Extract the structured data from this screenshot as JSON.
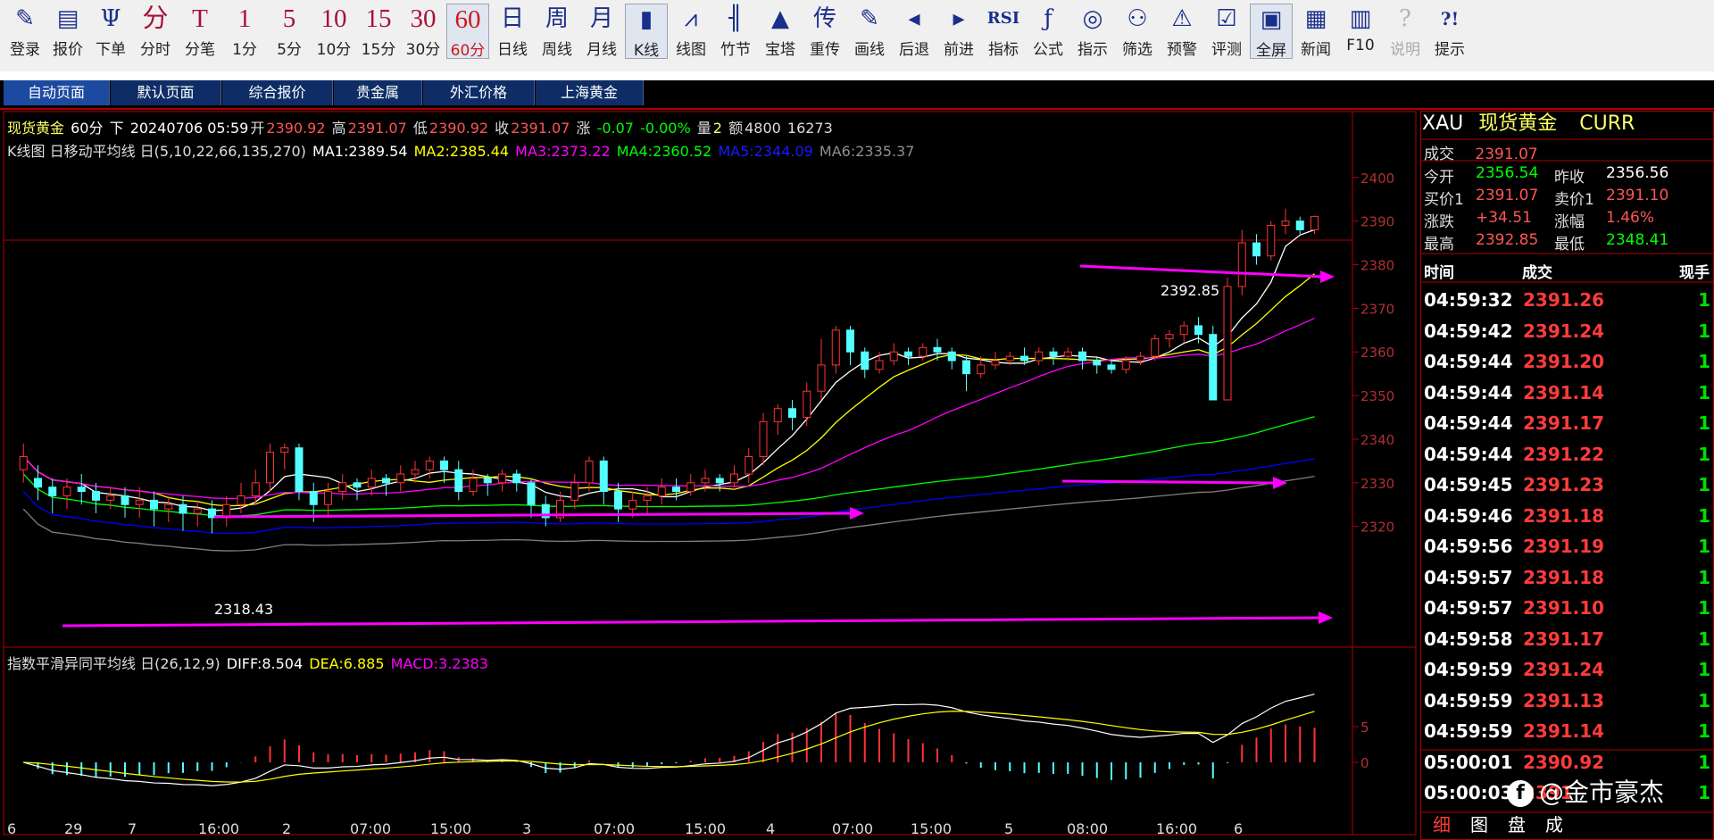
{
  "toolbar": {
    "items": [
      {
        "label": "登录",
        "icon": "pencil-icon",
        "glyph": "✎"
      },
      {
        "label": "报价",
        "icon": "quote-icon",
        "glyph": "▤"
      },
      {
        "label": "下单",
        "icon": "order-icon",
        "glyph": "Ψ"
      },
      {
        "label": "分时",
        "icon": "",
        "glyph": "分"
      },
      {
        "label": "分笔",
        "icon": "",
        "glyph": "T"
      },
      {
        "label": "1分",
        "icon": "",
        "glyph": "1"
      },
      {
        "label": "5分",
        "icon": "",
        "glyph": "5"
      },
      {
        "label": "10分",
        "icon": "",
        "glyph": "10"
      },
      {
        "label": "15分",
        "icon": "",
        "glyph": "15"
      },
      {
        "label": "30分",
        "icon": "",
        "glyph": "30"
      },
      {
        "label": "60分",
        "icon": "",
        "glyph": "60"
      },
      {
        "label": "日线",
        "icon": "",
        "glyph": "日"
      },
      {
        "label": "周线",
        "icon": "",
        "glyph": "周"
      },
      {
        "label": "月线",
        "icon": "",
        "glyph": "月"
      },
      {
        "label": "K线",
        "icon": "candlestick-icon",
        "glyph": "▮"
      },
      {
        "label": "线图",
        "icon": "line-chart-icon",
        "glyph": "⩘"
      },
      {
        "label": "竹节",
        "icon": "bamboo-icon",
        "glyph": "╢"
      },
      {
        "label": "宝塔",
        "icon": "tower-icon",
        "glyph": "▲"
      },
      {
        "label": "重传",
        "icon": "",
        "glyph": "传"
      },
      {
        "label": "画线",
        "icon": "draw-icon",
        "glyph": "✎"
      },
      {
        "label": "后退",
        "icon": "back-icon",
        "glyph": "◂"
      },
      {
        "label": "前进",
        "icon": "forward-icon",
        "glyph": "▸"
      },
      {
        "label": "指标",
        "icon": "rsi-icon",
        "glyph": "RSI"
      },
      {
        "label": "公式",
        "icon": "formula-icon",
        "glyph": "ƒ"
      },
      {
        "label": "指示",
        "icon": "indicator-icon",
        "glyph": "◎"
      },
      {
        "label": "筛选",
        "icon": "binoculars-icon",
        "glyph": "⚇"
      },
      {
        "label": "预警",
        "icon": "alarm-icon",
        "glyph": "⚠"
      },
      {
        "label": "评测",
        "icon": "evaluate-icon",
        "glyph": "☑"
      },
      {
        "label": "全屏",
        "icon": "fullscreen-icon",
        "glyph": "▣"
      },
      {
        "label": "新闻",
        "icon": "news-icon",
        "glyph": "▦"
      },
      {
        "label": "F10",
        "icon": "books-icon",
        "glyph": "▥"
      },
      {
        "label": "说明",
        "icon": "help-icon",
        "glyph": "?"
      },
      {
        "label": "提示",
        "icon": "hint-icon",
        "glyph": "?!"
      }
    ]
  },
  "tabs": [
    "自动页面",
    "默认页面",
    "综合报价",
    "贵金属",
    "外汇价格",
    "上海黄金"
  ],
  "info": {
    "name": "现货黄金",
    "period": "60分",
    "dir": "下",
    "date": "20240706 05:59",
    "open_label": "开",
    "open": "2390.92",
    "high_label": "高",
    "high": "2391.07",
    "low_label": "低",
    "low": "2390.92",
    "close_label": "收",
    "close": "2391.07",
    "chg_label": "涨",
    "chg": "-0.07",
    "chg_pct": "-0.00%",
    "vol_label": "量",
    "vol": "2",
    "amt_label": "额",
    "amt": "4800",
    "amt2": "16273"
  },
  "ma_line": {
    "prefix": "K线图 日移动平均线 日(5,10,22,66,135,270)",
    "ma1": "MA1:2389.54",
    "ma2": "MA2:2385.44",
    "ma3": "MA3:2373.22",
    "ma4": "MA4:2360.52",
    "ma5": "MA5:2344.09",
    "ma6": "MA6:2335.37"
  },
  "macd_line": {
    "prefix": "指数平滑异同平均线 日(26,12,9)",
    "diff": "DIFF:8.504",
    "dea": "DEA:6.885",
    "macd": "MACD:3.2383"
  },
  "colors": {
    "up": "#ff3333",
    "down": "#54ffff",
    "ma1": "#ffffff",
    "ma2": "#ffff00",
    "ma3": "#ff00ff",
    "ma4": "#00ff00",
    "ma5": "#0000ff",
    "ma6": "#808080",
    "arrow": "#ff00ff"
  },
  "annotations": {
    "high": "2392.85",
    "low": "2318.43"
  },
  "quote": {
    "symbol": "XAU",
    "name": "现货黄金",
    "currency": "CURR",
    "last_label": "成交",
    "last": "2391.07",
    "open_label": "今开",
    "open": "2356.54",
    "prev_label": "昨收",
    "prev": "2356.56",
    "bid_label": "买价1",
    "bid": "2391.07",
    "ask_label": "卖价1",
    "ask": "2391.10",
    "chg_label": "涨跌",
    "chg": "+34.51",
    "pct_label": "涨幅",
    "pct": "1.46%",
    "high_label": "最高",
    "high": "2392.85",
    "low_label": "最低",
    "low": "2348.41"
  },
  "trades_header": {
    "time": "时间",
    "price": "成交",
    "vol": "现手"
  },
  "trades": [
    {
      "time": "04:59:32",
      "price": "2391.26",
      "vol": "1"
    },
    {
      "time": "04:59:42",
      "price": "2391.24",
      "vol": "1"
    },
    {
      "time": "04:59:44",
      "price": "2391.20",
      "vol": "1"
    },
    {
      "time": "04:59:44",
      "price": "2391.14",
      "vol": "1"
    },
    {
      "time": "04:59:44",
      "price": "2391.17",
      "vol": "1"
    },
    {
      "time": "04:59:44",
      "price": "2391.22",
      "vol": "1"
    },
    {
      "time": "04:59:45",
      "price": "2391.23",
      "vol": "1"
    },
    {
      "time": "04:59:46",
      "price": "2391.18",
      "vol": "1"
    },
    {
      "time": "04:59:56",
      "price": "2391.19",
      "vol": "1"
    },
    {
      "time": "04:59:57",
      "price": "2391.18",
      "vol": "1"
    },
    {
      "time": "04:59:57",
      "price": "2391.10",
      "vol": "1"
    },
    {
      "time": "04:59:58",
      "price": "2391.17",
      "vol": "1"
    },
    {
      "time": "04:59:59",
      "price": "2391.24",
      "vol": "1"
    },
    {
      "time": "04:59:59",
      "price": "2391.13",
      "vol": "1"
    },
    {
      "time": "04:59:59",
      "price": "2391.14",
      "vol": "1"
    },
    {
      "time": "05:00:01",
      "price": "2390.92",
      "vol": "1"
    },
    {
      "time": "05:00:03",
      "price": "2391",
      "vol": "1"
    }
  ],
  "bottom_tabs": [
    "细",
    "图",
    "盘",
    "成"
  ],
  "watermark": "@金市豪杰",
  "watermark_icon": "f",
  "chart_data": {
    "type": "candlestick",
    "price_ticks": [
      2400,
      2390,
      2380,
      2370,
      2360,
      2350,
      2340,
      2330,
      2320
    ],
    "ylim": [
      2314,
      2402
    ],
    "macd_ticks": [
      5,
      0
    ],
    "macd_ylim": [
      -5,
      15
    ],
    "x_labels": [
      "6",
      "29",
      "7",
      "16:00",
      "2",
      "07:00",
      "15:00",
      "3",
      "07:00",
      "15:00",
      "4",
      "07:00",
      "15:00",
      "5",
      "08:00",
      "16:00",
      "6"
    ],
    "candles": [
      [
        2333,
        2336,
        2330,
        2339
      ],
      [
        2331,
        2329,
        2326,
        2334
      ],
      [
        2329,
        2327,
        2323,
        2331
      ],
      [
        2327,
        2329,
        2324,
        2331
      ],
      [
        2329,
        2328,
        2325,
        2332
      ],
      [
        2328,
        2326,
        2323,
        2330
      ],
      [
        2326,
        2327,
        2324,
        2329
      ],
      [
        2327,
        2325,
        2322,
        2329
      ],
      [
        2325,
        2326,
        2322,
        2329
      ],
      [
        2326,
        2324,
        2320,
        2328
      ],
      [
        2324,
        2325,
        2321,
        2327
      ],
      [
        2325,
        2323,
        2319,
        2327
      ],
      [
        2323,
        2324,
        2320,
        2326
      ],
      [
        2324,
        2322,
        2318.43,
        2326
      ],
      [
        2322,
        2325,
        2320,
        2327
      ],
      [
        2325,
        2327,
        2323,
        2330
      ],
      [
        2327,
        2330,
        2325,
        2333
      ],
      [
        2330,
        2337,
        2328,
        2339
      ],
      [
        2337,
        2338,
        2333,
        2339
      ],
      [
        2338,
        2328,
        2326,
        2339
      ],
      [
        2328,
        2325,
        2321,
        2330
      ],
      [
        2325,
        2328,
        2322,
        2330
      ],
      [
        2328,
        2330,
        2326,
        2332
      ],
      [
        2330,
        2329,
        2326,
        2331
      ],
      [
        2329,
        2331,
        2327,
        2333
      ],
      [
        2331,
        2330,
        2327,
        2332
      ],
      [
        2330,
        2332,
        2328,
        2334
      ],
      [
        2332,
        2333,
        2330,
        2335
      ],
      [
        2333,
        2335,
        2331,
        2336
      ],
      [
        2335,
        2333,
        2330,
        2336
      ],
      [
        2333,
        2328,
        2326,
        2335
      ],
      [
        2328,
        2331,
        2327,
        2333
      ],
      [
        2331,
        2330,
        2327,
        2332
      ],
      [
        2330,
        2332,
        2328,
        2333
      ],
      [
        2332,
        2330,
        2328,
        2333
      ],
      [
        2330,
        2325,
        2322,
        2331
      ],
      [
        2325,
        2322,
        2320,
        2327
      ],
      [
        2322,
        2326,
        2321,
        2328
      ],
      [
        2326,
        2330,
        2324,
        2332
      ],
      [
        2330,
        2335,
        2328,
        2336
      ],
      [
        2335,
        2328,
        2325,
        2336
      ],
      [
        2328,
        2324,
        2321,
        2330
      ],
      [
        2324,
        2326,
        2322,
        2328
      ],
      [
        2326,
        2327,
        2323,
        2329
      ],
      [
        2327,
        2329,
        2325,
        2331
      ],
      [
        2329,
        2328,
        2326,
        2331
      ],
      [
        2328,
        2330,
        2327,
        2332
      ],
      [
        2330,
        2331,
        2328,
        2333
      ],
      [
        2331,
        2330,
        2328,
        2332
      ],
      [
        2330,
        2332,
        2329,
        2334
      ],
      [
        2332,
        2336,
        2330,
        2338
      ],
      [
        2336,
        2344,
        2334,
        2346
      ],
      [
        2344,
        2347,
        2341,
        2348
      ],
      [
        2347,
        2345,
        2342,
        2349
      ],
      [
        2345,
        2351,
        2343,
        2353
      ],
      [
        2351,
        2357,
        2349,
        2363
      ],
      [
        2357,
        2365,
        2355,
        2366
      ],
      [
        2365,
        2360,
        2357,
        2366
      ],
      [
        2360,
        2356,
        2354,
        2361
      ],
      [
        2356,
        2358,
        2355,
        2360
      ],
      [
        2358,
        2360,
        2357,
        2362
      ],
      [
        2360,
        2359,
        2357,
        2361
      ],
      [
        2359,
        2361,
        2358,
        2362
      ],
      [
        2361,
        2360,
        2358,
        2363
      ],
      [
        2360,
        2358,
        2356,
        2361
      ],
      [
        2358,
        2355,
        2351,
        2359
      ],
      [
        2355,
        2357,
        2354,
        2359
      ],
      [
        2357,
        2358,
        2356,
        2360
      ],
      [
        2358,
        2359,
        2357,
        2360
      ],
      [
        2359,
        2358,
        2357,
        2361
      ],
      [
        2358,
        2360,
        2357,
        2361
      ],
      [
        2360,
        2359,
        2357,
        2361
      ],
      [
        2359,
        2360,
        2358,
        2361
      ],
      [
        2360,
        2358,
        2356,
        2361
      ],
      [
        2358,
        2357,
        2355,
        2359
      ],
      [
        2357,
        2356,
        2355,
        2358
      ],
      [
        2356,
        2358,
        2355,
        2359
      ],
      [
        2358,
        2359,
        2357,
        2360
      ],
      [
        2359,
        2363,
        2358,
        2364
      ],
      [
        2363,
        2364,
        2361,
        2365
      ],
      [
        2364,
        2366,
        2362,
        2367
      ],
      [
        2366,
        2364,
        2362,
        2368
      ],
      [
        2364,
        2349,
        2349,
        2366
      ],
      [
        2349,
        2375,
        2349,
        2377
      ],
      [
        2375,
        2385,
        2373,
        2388
      ],
      [
        2385,
        2382,
        2380,
        2387
      ],
      [
        2382,
        2389,
        2381,
        2390
      ],
      [
        2389,
        2390,
        2387,
        2392.85
      ],
      [
        2390,
        2388,
        2387,
        2391
      ],
      [
        2388,
        2391.07,
        2387,
        2391.26
      ]
    ]
  }
}
